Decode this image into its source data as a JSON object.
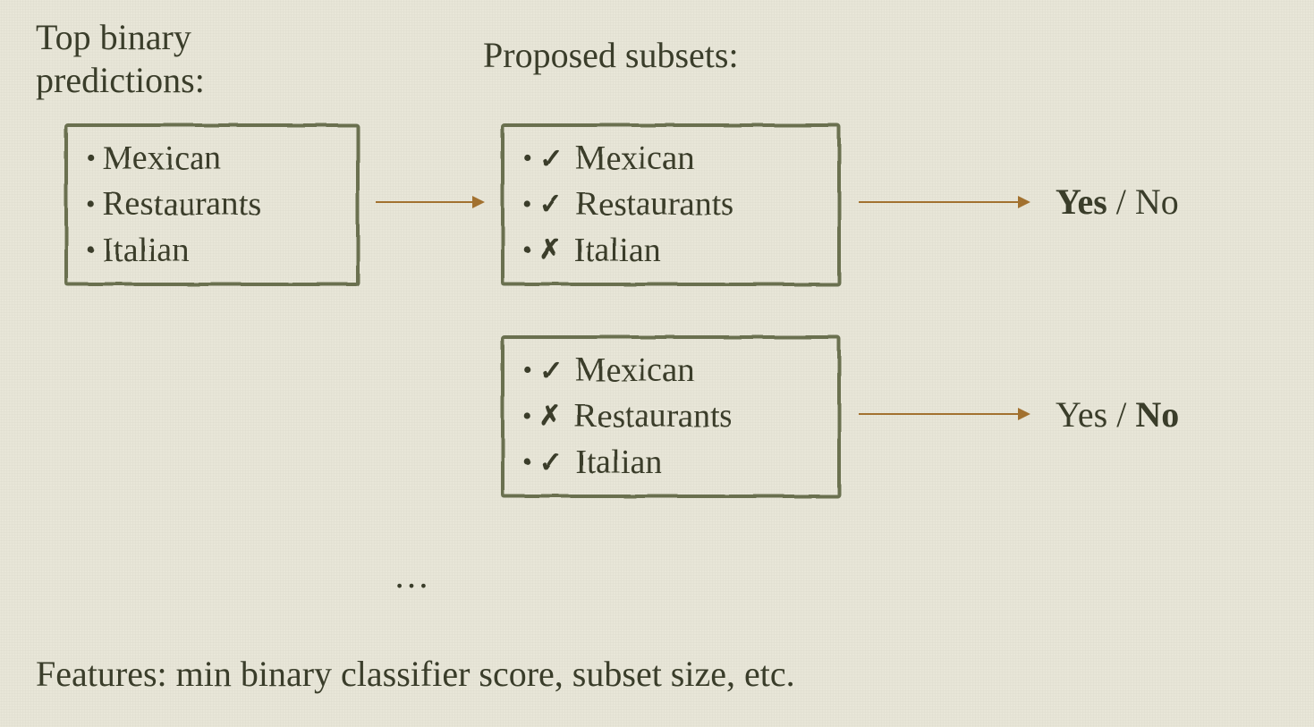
{
  "headings": {
    "left_line1": "Top binary",
    "left_line2": "predictions:",
    "right": "Proposed subsets:"
  },
  "predictions": {
    "items": [
      "Mexican",
      "Restaurants",
      "Italian"
    ]
  },
  "subsets": [
    {
      "items": [
        {
          "mark": "check",
          "label": "Mexican"
        },
        {
          "mark": "check",
          "label": "Restaurants"
        },
        {
          "mark": "cross",
          "label": "Italian"
        }
      ],
      "decision": {
        "yes": "Yes",
        "no": "No",
        "bold": "yes"
      }
    },
    {
      "items": [
        {
          "mark": "check",
          "label": "Mexican"
        },
        {
          "mark": "cross",
          "label": "Restaurants"
        },
        {
          "mark": "check",
          "label": "Italian"
        }
      ],
      "decision": {
        "yes": "Yes",
        "no": "No",
        "bold": "no"
      }
    }
  ],
  "ellipsis": "…",
  "footer": "Features: min binary classifier score, subset size, etc.",
  "separator": " / "
}
